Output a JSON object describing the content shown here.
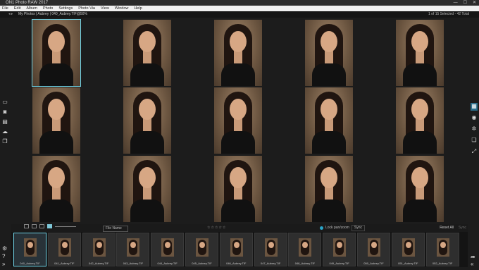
{
  "titlebar": {
    "app_name": "ON1 Photo RAW 2017",
    "minimize": "—",
    "maximize": "☐",
    "close": "✕"
  },
  "menu": [
    "File",
    "Edit",
    "Album",
    "Photo",
    "Settings",
    "Photo Via",
    "View",
    "Window",
    "Help"
  ],
  "path": {
    "back": "◂ ▸",
    "crumbs": "My Photos | Aubrey | 040_Aubrey.TIF@50%",
    "selection_count": "1 of 15 Selected - 42 Total"
  },
  "left_icons": [
    "monitor-icon",
    "camera-icon",
    "printer-icon",
    "cloud-icon",
    "photos-icon"
  ],
  "right_icons": [
    "browse-icon",
    "develop-icon",
    "effects-icon",
    "layers-icon",
    "resize-icon"
  ],
  "grid": {
    "rows": 3,
    "cols": 5,
    "selected_index": 0
  },
  "toolbar": {
    "sort_label": "File Name",
    "rating_stars": "☆☆☆☆☆",
    "lock_label": "Lock pan/zoom",
    "sync_label": "Sync",
    "reset_label": "Reset All",
    "sync_right_label": "Sync"
  },
  "filmstrip": [
    {
      "name": "040_Aubrey.TIF",
      "selected": true
    },
    {
      "name": "041_Aubrey.TIF",
      "selected": false
    },
    {
      "name": "042_Aubrey.TIF",
      "selected": false
    },
    {
      "name": "043_Aubrey.TIF",
      "selected": false
    },
    {
      "name": "044_Aubrey.TIF",
      "selected": false
    },
    {
      "name": "045_Aubrey.TIF",
      "selected": false
    },
    {
      "name": "046_Aubrey.TIF",
      "selected": false
    },
    {
      "name": "047_Aubrey.TIF",
      "selected": false
    },
    {
      "name": "048_Aubrey.TIF",
      "selected": false
    },
    {
      "name": "049_Aubrey.TIF",
      "selected": false
    },
    {
      "name": "050_Aubrey.TIF",
      "selected": false
    },
    {
      "name": "051_Aubrey.TIF",
      "selected": false
    },
    {
      "name": "052_Aubrey.TIF",
      "selected": false
    }
  ],
  "colors": {
    "accent": "#6fd3e6",
    "background": "#1c1c1c"
  }
}
